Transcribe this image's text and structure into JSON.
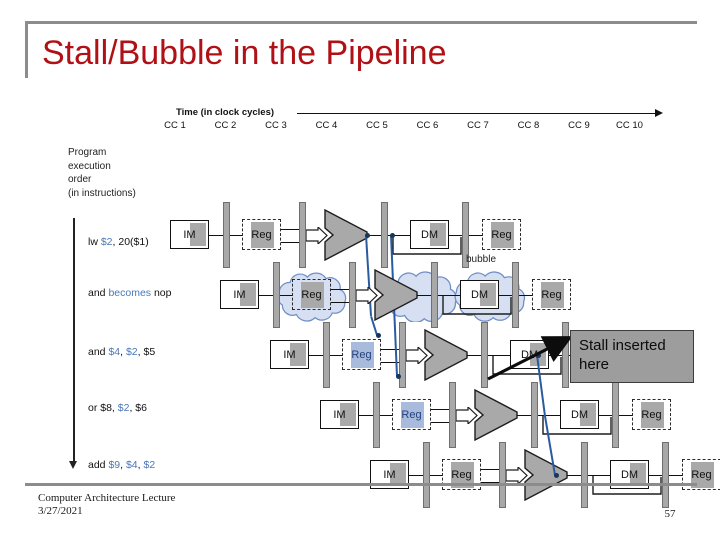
{
  "slide": {
    "title": "Stall/Bubble in the Pipeline",
    "title_color": "#b01116",
    "footer": "Computer Architecture Lecture\n3/27/2021",
    "page_number": "57"
  },
  "figure": {
    "time_axis_label": "Time (in clock cycles)",
    "cc_labels": [
      "CC 1",
      "CC 2",
      "CC 3",
      "CC 4",
      "CC 5",
      "CC 6",
      "CC 7",
      "CC 8",
      "CC 9",
      "CC 10"
    ],
    "program_order_label": "Program\nexecution\norder\n(in instructions)",
    "bubble_label": "bubble",
    "stage_labels": {
      "im": "IM",
      "reg": "Reg",
      "dm": "DM"
    },
    "instructions": [
      {
        "text_plain": "lw $2, 20($1)",
        "parts": [
          {
            "t": "lw ",
            "c": "black"
          },
          {
            "t": "$2",
            "c": "blue"
          },
          {
            "t": ", 20($1)",
            "c": "black"
          }
        ]
      },
      {
        "text_plain": "and becomes nop",
        "parts": [
          {
            "t": "and ",
            "c": "black"
          },
          {
            "t": "becomes ",
            "c": "blue"
          },
          {
            "t": "nop",
            "c": "black"
          }
        ]
      },
      {
        "text_plain": "and $4, $2, $5",
        "parts": [
          {
            "t": "and ",
            "c": "black"
          },
          {
            "t": "$4",
            "c": "blue"
          },
          {
            "t": ", ",
            "c": "black"
          },
          {
            "t": "$2",
            "c": "blue"
          },
          {
            "t": ", ",
            "c": "black"
          },
          {
            "t": "$5",
            "c": "black"
          }
        ]
      },
      {
        "text_plain": "or $8, $2, $6",
        "parts": [
          {
            "t": "or $8, ",
            "c": "black"
          },
          {
            "t": "$2",
            "c": "blue"
          },
          {
            "t": ", $6",
            "c": "black"
          }
        ]
      },
      {
        "text_plain": "add $9, $4, $2",
        "parts": [
          {
            "t": "add ",
            "c": "black"
          },
          {
            "t": "$9",
            "c": "blue"
          },
          {
            "t": ", ",
            "c": "black"
          },
          {
            "t": "$4",
            "c": "blue"
          },
          {
            "t": ", ",
            "c": "black"
          },
          {
            "t": "$2",
            "c": "blue"
          }
        ]
      }
    ],
    "colors": {
      "unit_fill": "#a9a9a9",
      "blue_reg_fill": "#a8bbdd",
      "forward_line": "#2a5ba0",
      "bubble_fill": "#d7e0f2",
      "bubble_stroke": "#6f8fc6",
      "pipe_bar": "#a8a8a8"
    }
  },
  "callout": {
    "text": "Stall inserted\nhere",
    "background": "#9d9d9d",
    "border": "#3c3c3c"
  }
}
